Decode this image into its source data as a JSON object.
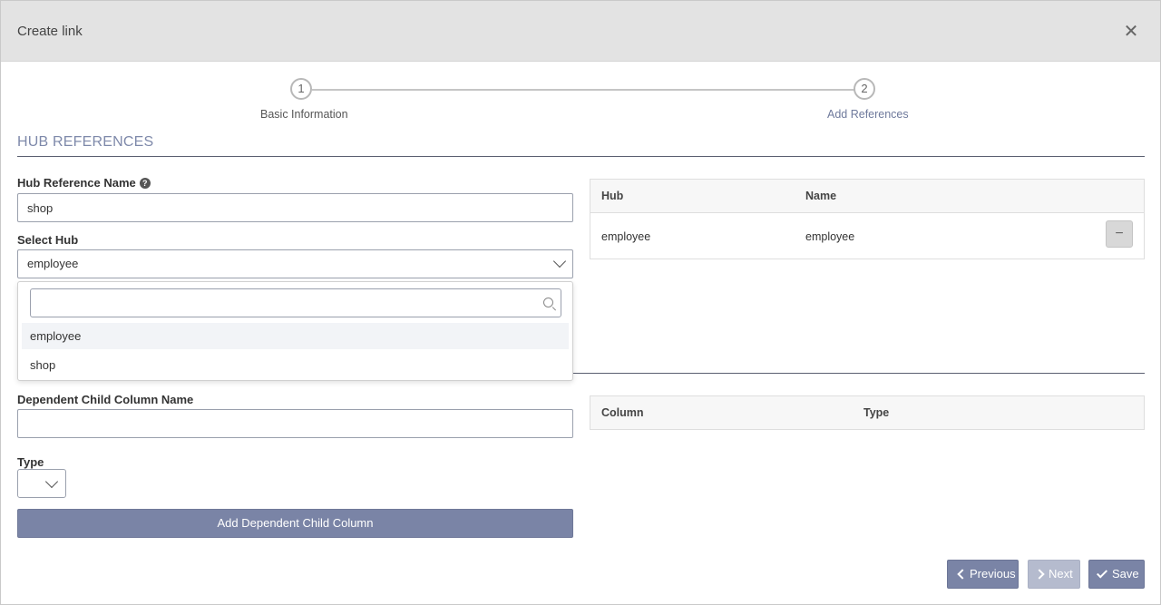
{
  "modal": {
    "title": "Create link",
    "close_icon": "close-icon"
  },
  "stepper": {
    "steps": [
      {
        "number": "1",
        "label": "Basic Information",
        "state": "completed"
      },
      {
        "number": "2",
        "label": "Add References",
        "state": "active"
      }
    ]
  },
  "hub_references": {
    "section_title": "HUB REFERENCES",
    "name_label": "Hub Reference Name",
    "name_value": "shop",
    "help_icon": "question-circle-icon",
    "select_label": "Select Hub",
    "select_value": "employee",
    "dropdown": {
      "search_value": "",
      "search_icon": "search-icon",
      "options": [
        "employee",
        "shop"
      ],
      "highlighted": "employee"
    },
    "table": {
      "columns": [
        "Hub",
        "Name"
      ],
      "rows": [
        {
          "hub": "employee",
          "name": "employee",
          "action_icon": "minus-icon"
        }
      ]
    }
  },
  "dependent_child": {
    "column_name_label": "Dependent Child Column Name",
    "column_name_value": "",
    "type_label": "Type",
    "type_value": "",
    "add_button_label": "Add Dependent Child Column",
    "table": {
      "columns": [
        "Column",
        "Type"
      ],
      "rows": []
    }
  },
  "footer": {
    "previous_label": "Previous",
    "next_label": "Next",
    "save_label": "Save",
    "next_disabled": true
  },
  "colors": {
    "accent": "#7a84a6",
    "accent_disabled": "#b5bbce",
    "header_bg": "#e3e3e3",
    "section_title": "#7e89aa"
  }
}
